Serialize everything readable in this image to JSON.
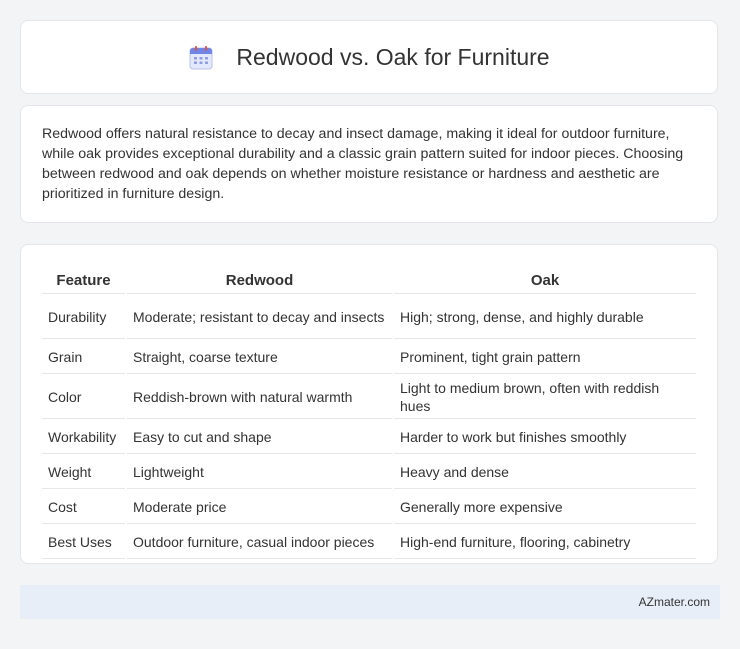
{
  "header": {
    "title": "Redwood vs. Oak for Furniture",
    "icon": "calendar-icon"
  },
  "intro": "Redwood offers natural resistance to decay and insect damage, making it ideal for outdoor furniture, while oak provides exceptional durability and a classic grain pattern suited for indoor pieces. Choosing between redwood and oak depends on whether moisture resistance or hardness and aesthetic are prioritized in furniture design.",
  "table": {
    "columns": [
      "Feature",
      "Redwood",
      "Oak"
    ],
    "rows": [
      {
        "feature": "Durability",
        "redwood": "Moderate; resistant to decay and insects",
        "oak": "High; strong, dense, and highly durable"
      },
      {
        "feature": "Grain",
        "redwood": "Straight, coarse texture",
        "oak": "Prominent, tight grain pattern"
      },
      {
        "feature": "Color",
        "redwood": "Reddish-brown with natural warmth",
        "oak": "Light to medium brown, often with reddish hues"
      },
      {
        "feature": "Workability",
        "redwood": "Easy to cut and shape",
        "oak": "Harder to work but finishes smoothly"
      },
      {
        "feature": "Weight",
        "redwood": "Lightweight",
        "oak": "Heavy and dense"
      },
      {
        "feature": "Cost",
        "redwood": "Moderate price",
        "oak": "Generally more expensive"
      },
      {
        "feature": "Best Uses",
        "redwood": "Outdoor furniture, casual indoor pieces",
        "oak": "High-end furniture, flooring, cabinetry"
      }
    ]
  },
  "footer": {
    "brand": "AZmater.com"
  }
}
